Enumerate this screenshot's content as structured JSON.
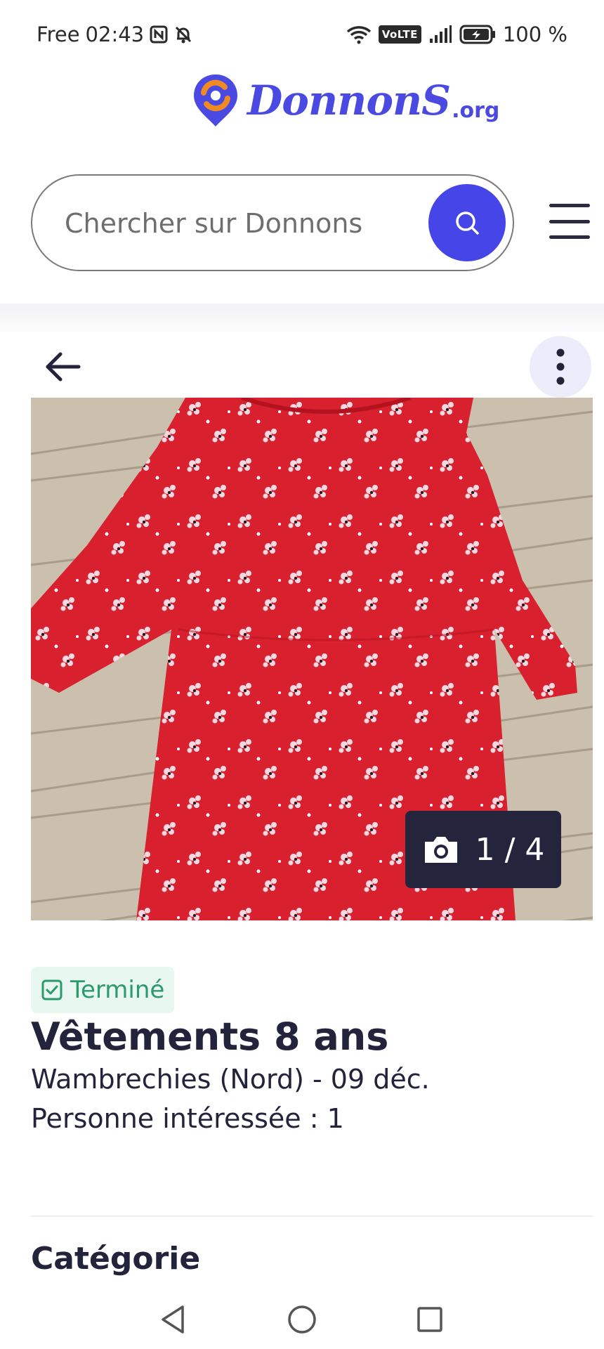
{
  "status_bar": {
    "carrier": "Free",
    "time": "02:43",
    "volte": "VoLTE",
    "battery": "100 %"
  },
  "logo": {
    "word": "DonnonS",
    "ext": ".org"
  },
  "search": {
    "placeholder": "Chercher sur Donnons"
  },
  "listing": {
    "photo_counter": "1 / 4",
    "photo_current": 1,
    "photo_total": 4,
    "status": "Terminé",
    "title": "Vêtements 8 ans",
    "location": "Wambrechies (Nord) - 09 déc.",
    "interested": "Personne intéressée : 1"
  },
  "sections": {
    "category_title": "Catégorie"
  },
  "icons": [
    "nfc-icon",
    "bell-off-icon",
    "wifi-icon",
    "signal-icon",
    "battery-icon",
    "search-icon",
    "menu-icon",
    "back-arrow-icon",
    "more-vertical-icon",
    "camera-icon",
    "check-square-icon",
    "nav-back-icon",
    "nav-home-icon",
    "nav-recents-icon"
  ],
  "colors": {
    "brand": "#4a4ae2",
    "accent_orange": "#f08a24",
    "success": "#2b9a6c",
    "dark": "#23233c",
    "dress_red": "#d8202f"
  }
}
